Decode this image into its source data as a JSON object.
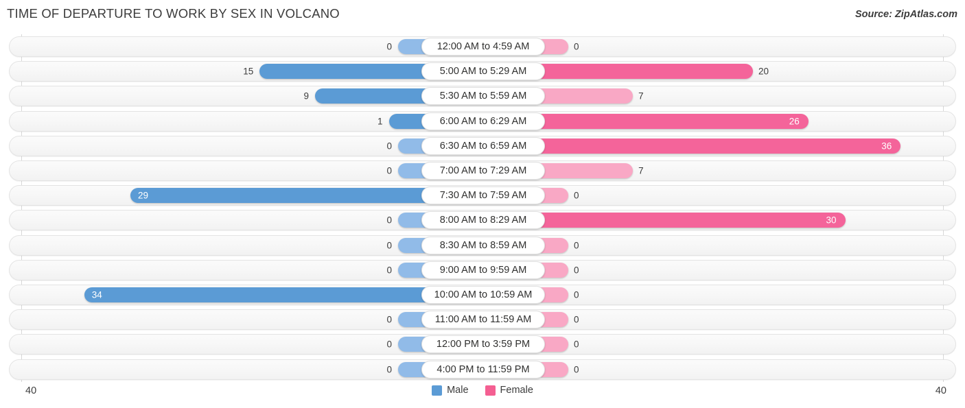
{
  "header": {
    "title": "TIME OF DEPARTURE TO WORK BY SEX IN VOLCANO",
    "source": "Source: ZipAtlas.com"
  },
  "axis": {
    "left_max_label": "40",
    "right_max_label": "40"
  },
  "legend": {
    "items": [
      {
        "label": "Male",
        "color": "#5b9bd5"
      },
      {
        "label": "Female",
        "color": "#f45f92"
      }
    ]
  },
  "colors": {
    "male_light": "#91bbe8",
    "male_dark": "#5b9bd5",
    "female_light": "#f9a8c5",
    "female_dark": "#f4649a",
    "track": "#f6f6f6",
    "track_border": "#e3e3e3",
    "text": "#3c3c3c"
  },
  "chart_data": {
    "type": "bar",
    "title": "TIME OF DEPARTURE TO WORK BY SEX IN VOLCANO",
    "subtitle": "Source: ZipAtlas.com",
    "orientation": "horizontal-diverging",
    "xlabel": "",
    "ylabel": "",
    "xlim": [
      40,
      40
    ],
    "grid": false,
    "legend_position": "bottom-center",
    "categories": [
      "12:00 AM to 4:59 AM",
      "5:00 AM to 5:29 AM",
      "5:30 AM to 5:59 AM",
      "6:00 AM to 6:29 AM",
      "6:30 AM to 6:59 AM",
      "7:00 AM to 7:29 AM",
      "7:30 AM to 7:59 AM",
      "8:00 AM to 8:29 AM",
      "8:30 AM to 8:59 AM",
      "9:00 AM to 9:59 AM",
      "10:00 AM to 10:59 AM",
      "11:00 AM to 11:59 AM",
      "12:00 PM to 3:59 PM",
      "4:00 PM to 11:59 PM"
    ],
    "series": [
      {
        "name": "Male",
        "values": [
          0,
          15,
          9,
          1,
          0,
          0,
          29,
          0,
          0,
          0,
          34,
          0,
          0,
          0
        ]
      },
      {
        "name": "Female",
        "values": [
          0,
          20,
          7,
          26,
          36,
          7,
          0,
          30,
          0,
          0,
          0,
          0,
          0,
          0
        ]
      }
    ]
  }
}
